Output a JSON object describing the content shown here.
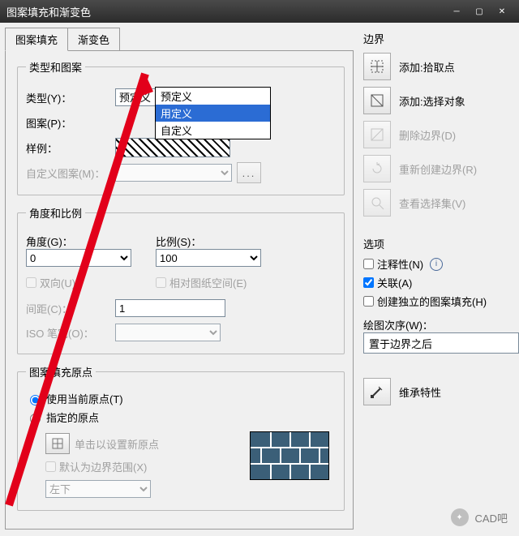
{
  "window_title": "图案填充和渐变色",
  "tabs": {
    "hatch": "图案填充",
    "grad": "渐变色"
  },
  "group_type": {
    "legend": "类型和图案",
    "type_label": "类型(Y)：",
    "type_value": "预定义",
    "type_options": [
      "预定义",
      "用定义",
      "自定义"
    ],
    "pattern_label": "图案(P)：",
    "sample_label": "样例：",
    "custom_pattern_label": "自定义图案(M)："
  },
  "group_angle": {
    "legend": "角度和比例",
    "angle_label": "角度(G)：",
    "angle_value": "0",
    "scale_label": "比例(S)：",
    "scale_value": "100",
    "twoway_label": "双向(U)",
    "relpaper_label": "相对图纸空间(E)",
    "spacing_label": "间距(C)：",
    "spacing_value": "1",
    "iso_label": "ISO 笔宽(O)："
  },
  "group_origin": {
    "legend": "图案填充原点",
    "use_current": "使用当前原点(T)",
    "specified": "指定的原点",
    "click_set": "单击以设置新原点",
    "default_ext": "默认为边界范围(X)",
    "leftbottom": "左下"
  },
  "right": {
    "boundary": "边界",
    "add_pick": "添加:拾取点",
    "add_select": "添加:选择对象",
    "del_boundary": "删除边界(D)",
    "rebuild": "重新创建边界(R)",
    "view_sel": "查看选择集(V)",
    "options": "选项",
    "annotative": "注释性(N)",
    "associative": "关联(A)",
    "separate": "创建独立的图案填充(H)",
    "draw_order_label": "绘图次序(W)：",
    "draw_order_value": "置于边界之后",
    "inherit": "维承特性"
  },
  "watermark": "CAD吧"
}
